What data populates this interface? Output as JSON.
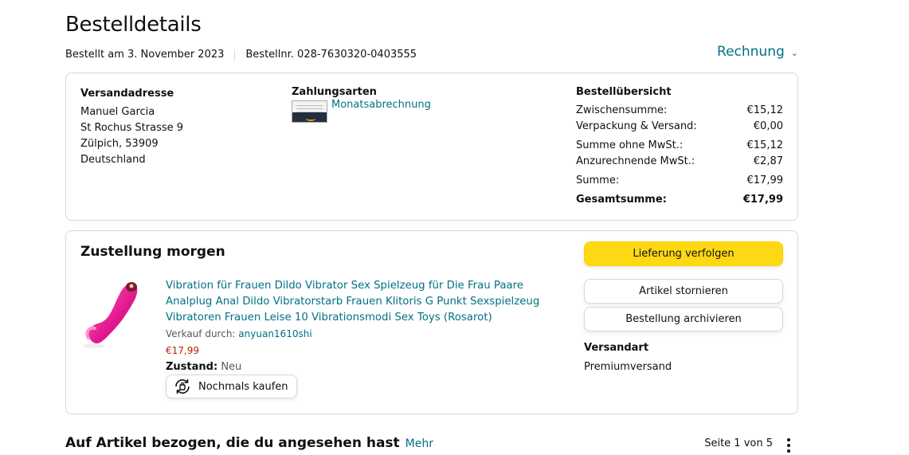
{
  "page": {
    "title": "Bestelldetails",
    "order_date": "Bestellt am 3. November 2023",
    "order_number": "Bestellnr. 028-7630320-0403555",
    "invoice_label": "Rechnung"
  },
  "address": {
    "heading": "Versandadresse",
    "name": "Manuel Garcia",
    "street": "St Rochus Strasse 9",
    "city": "Zülpich, 53909",
    "country": "Deutschland"
  },
  "payment": {
    "heading": "Zahlungsarten",
    "method": "Monatsabrechnung",
    "icon": "amazon-card-icon"
  },
  "order_summary": {
    "heading": "Bestellübersicht",
    "rows": [
      {
        "label": "Zwischensumme:",
        "value": "€15,12"
      },
      {
        "label": "Verpackung & Versand:",
        "value": "€0,00"
      },
      {
        "label": "Summe ohne MwSt.:",
        "value": "€15,12"
      },
      {
        "label": "Anzurechnende MwSt.:",
        "value": "€2,87"
      },
      {
        "label": "Summe:",
        "value": "€17,99"
      }
    ],
    "total_label": "Gesamtsumme:",
    "total_value": "€17,99"
  },
  "shipment": {
    "heading": "Zustellung morgen",
    "product_title": "Vibration für Frauen Dildo Vibrator Sex Spielzeug für Die Frau Paare Analplug Anal Dildo Vibratorstarb Frauen Klitoris G Punkt Sexspielzeug Vibratoren Frauen Leise 10 Vibrationsmodi Sex Toys (Rosarot)",
    "seller_prefix": "Verkauf durch:",
    "seller": "anyuan1610shi",
    "price": "€17,99",
    "condition_label": "Zustand:",
    "condition_value": "Neu",
    "rebuy_label": "Nochmals kaufen",
    "track_label": "Lieferung verfolgen",
    "cancel_label": "Artikel stornieren",
    "archive_label": "Bestellung archivieren",
    "shipping_method_heading": "Versandart",
    "shipping_method": "Premiumversand"
  },
  "related": {
    "heading": "Auf Artikel bezogen, die du angesehen hast",
    "more": "Mehr",
    "pager": "Seite 1 von 5"
  },
  "colors": {
    "link": "#007185",
    "price": "#b12704",
    "primary_button": "#ffd814",
    "border": "#d5d9d9"
  }
}
